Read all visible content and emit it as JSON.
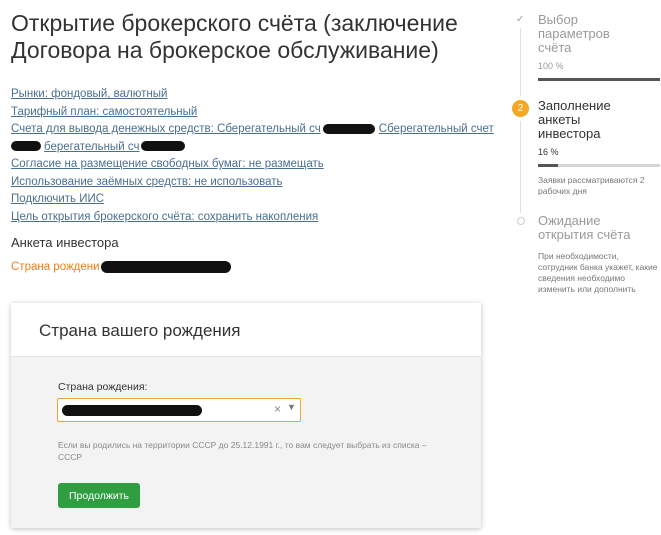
{
  "page": {
    "title": "Открытие брокерского счёта (заключение Договора на брокерское обслуживание)"
  },
  "summary_links": [
    {
      "text": "Рынки: фондовый, валютный"
    },
    {
      "text": "Тарифный план: самостоятельный"
    },
    {
      "text": "Счета для вывода денежных средств: Сберегательный сч",
      "text2": "Сберегательный счет"
    },
    {
      "text": "берегательный сч"
    },
    {
      "text": "Согласие на размещение свободных бумаг: не размещать"
    },
    {
      "text": "Использование заёмных средств: не использовать"
    },
    {
      "text": "Подключить ИИС"
    },
    {
      "text": "Цель открытия брокерского счёта: сохранить накопления"
    }
  ],
  "investor_section": {
    "title": "Анкета инвестора",
    "birth_label": "Страна рождени"
  },
  "card": {
    "title": "Страна вашего рождения",
    "field_label": "Страна рождения:",
    "clear_glyph": "×",
    "arrow_glyph": "▼",
    "hint": "Если вы родились на территории СССР до 25.12.1991 г., то вам следует выбрать из списка – СССР",
    "continue_label": "Продолжить"
  },
  "stepper": {
    "steps": [
      {
        "marker": "✓",
        "title": "Выбор параметров счёта",
        "percent": "100 %",
        "progress": 1.0
      },
      {
        "marker": "2",
        "title": "Заполнение анкеты инвестора",
        "percent": "16 %",
        "progress": 0.16,
        "note": "Заявки рассматриваются 2 рабочих дня"
      },
      {
        "marker": "",
        "title": "Ожидание открытия счёта",
        "note": "При необходимости, сотрудник банка укажет, какие сведения необходимо изменить или дополнить"
      }
    ]
  },
  "colors": {
    "link": "#4a6f8f",
    "accent_orange": "#f07f1a",
    "button_green": "#2f9e41",
    "step_active": "#f5a623"
  }
}
